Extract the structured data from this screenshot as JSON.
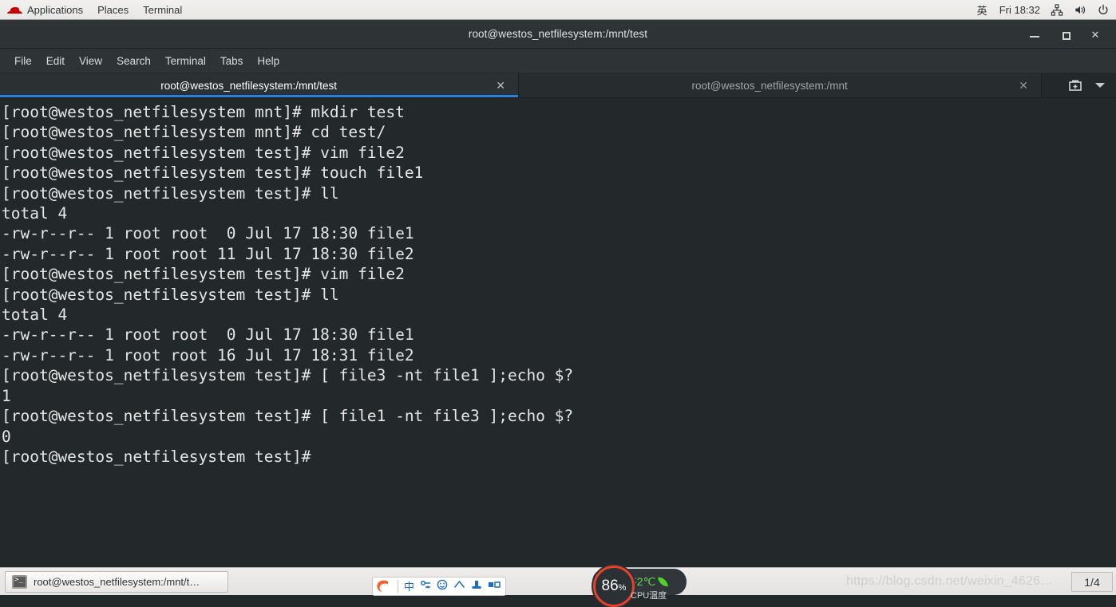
{
  "top_panel": {
    "logo": "redhat-logo",
    "menus": [
      "Applications",
      "Places",
      "Terminal"
    ],
    "ime_indicator": "英",
    "clock": "Fri 18:32",
    "tray_icons": [
      "network-icon",
      "volume-icon",
      "power-icon"
    ]
  },
  "window": {
    "title": "root@westos_netfilesystem:/mnt/test",
    "buttons": {
      "minimize": "minimize-button",
      "maximize": "maximize-button",
      "close": "✕"
    },
    "menubar": [
      "File",
      "Edit",
      "View",
      "Search",
      "Terminal",
      "Tabs",
      "Help"
    ],
    "tabs": [
      {
        "label": "root@westos_netfilesystem:/mnt/test",
        "active": true,
        "close": "✕"
      },
      {
        "label": "root@westos_netfilesystem:/mnt",
        "active": false,
        "close": "✕"
      }
    ],
    "tab_tools": {
      "new_tab": "new-tab-icon",
      "dropdown": "chevron-down-icon"
    }
  },
  "terminal": {
    "lines": [
      "[root@westos_netfilesystem mnt]# mkdir test",
      "[root@westos_netfilesystem mnt]# cd test/",
      "[root@westos_netfilesystem test]# vim file2",
      "[root@westos_netfilesystem test]# touch file1",
      "[root@westos_netfilesystem test]# ll",
      "total 4",
      "-rw-r--r-- 1 root root  0 Jul 17 18:30 file1",
      "-rw-r--r-- 1 root root 11 Jul 17 18:30 file2",
      "[root@westos_netfilesystem test]# vim file2",
      "[root@westos_netfilesystem test]# ll",
      "total 4",
      "-rw-r--r-- 1 root root  0 Jul 17 18:30 file1",
      "-rw-r--r-- 1 root root 16 Jul 17 18:31 file2",
      "[root@westos_netfilesystem test]# [ file3 -nt file1 ];echo $?",
      "1",
      "[root@westos_netfilesystem test]# [ file1 -nt file3 ];echo $?",
      "0",
      "[root@westos_netfilesystem test]#"
    ]
  },
  "taskbar": {
    "task_item": "root@westos_netfilesystem:/mnt/t…",
    "ime": {
      "logo": "sogou-logo",
      "icons": [
        "中",
        "ime-settings-icon",
        "emoji-icon",
        "cloud-icon",
        "toolbox-icon",
        "keyboard-icon"
      ]
    },
    "cpu_widget": {
      "percent": "86",
      "percent_unit": "%",
      "temperature": "52℃",
      "caption": "CPU温度",
      "ring_color": "#e8412a",
      "temp_color": "#63d84f"
    },
    "watermark": "https://blog.csdn.net/weixin_4626…",
    "workspace": "1/4"
  }
}
